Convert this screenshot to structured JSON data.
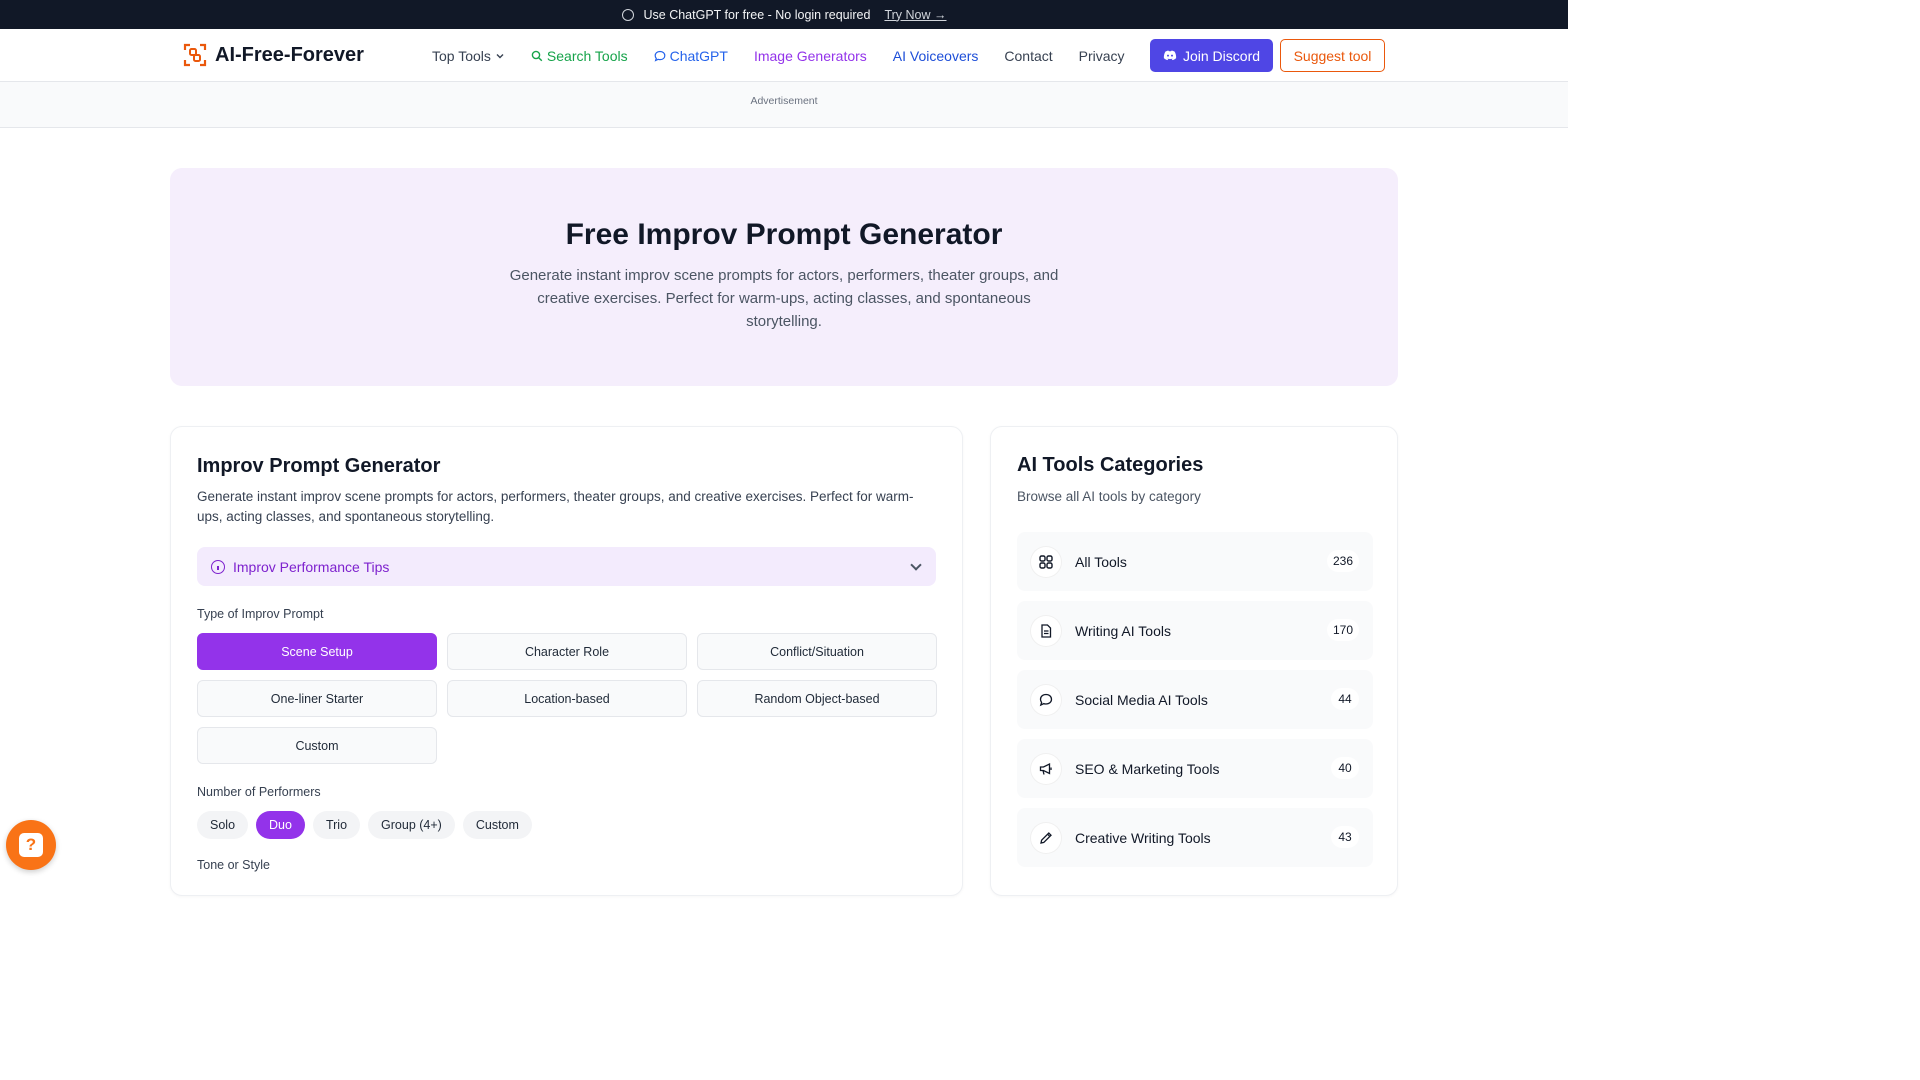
{
  "banner": {
    "text": "Use ChatGPT for free - No login required",
    "link": "Try Now →"
  },
  "nav": {
    "logo": "AI-Free-Forever",
    "links": {
      "top_tools": "Top Tools",
      "search_tools": "Search Tools",
      "chatgpt": "ChatGPT",
      "image_generators": "Image Generators",
      "ai_voiceovers": "AI Voiceovers",
      "contact": "Contact",
      "privacy": "Privacy"
    },
    "join_discord": "Join Discord",
    "suggest_tool": "Suggest tool"
  },
  "ad": {
    "label": "Advertisement"
  },
  "hero": {
    "title": "Free Improv Prompt Generator",
    "subtitle": "Generate instant improv scene prompts for actors, performers, theater groups, and creative exercises. Perfect for warm-ups, acting classes, and spontaneous storytelling."
  },
  "generator": {
    "title": "Improv Prompt Generator",
    "description": "Generate instant improv scene prompts for actors, performers, theater groups, and creative exercises. Perfect for warm-ups, acting classes, and spontaneous storytelling.",
    "tips_label": "Improv Performance Tips",
    "type_label": "Type of Improv Prompt",
    "types": [
      "Scene Setup",
      "Character Role",
      "Conflict/Situation",
      "One-liner Starter",
      "Location-based",
      "Random Object-based",
      "Custom"
    ],
    "selected_type": "Scene Setup",
    "performers_label": "Number of Performers",
    "performers": [
      "Solo",
      "Duo",
      "Trio",
      "Group (4+)",
      "Custom"
    ],
    "selected_performers": "Duo",
    "tone_label": "Tone or Style"
  },
  "categories": {
    "title": "AI Tools Categories",
    "subtitle": "Browse all AI tools by category",
    "items": [
      {
        "name": "All Tools",
        "count": "236",
        "icon": "grid-icon"
      },
      {
        "name": "Writing AI Tools",
        "count": "170",
        "icon": "document-icon"
      },
      {
        "name": "Social Media AI Tools",
        "count": "44",
        "icon": "chat-bubble-icon"
      },
      {
        "name": "SEO & Marketing Tools",
        "count": "40",
        "icon": "megaphone-icon"
      },
      {
        "name": "Creative Writing Tools",
        "count": "43",
        "icon": "pencil-icon"
      }
    ]
  },
  "colors": {
    "accent": "#9333ea",
    "hero_bg": "#f5eefc",
    "discord": "#4f46e5",
    "suggest": "#ea580c",
    "help": "#f97316"
  }
}
